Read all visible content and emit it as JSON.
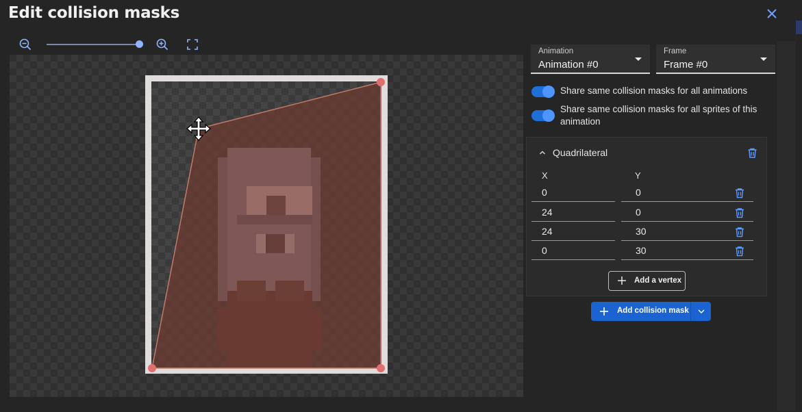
{
  "dialog": {
    "title": "Edit collision masks",
    "close_icon": "close-icon"
  },
  "toolbar": {
    "zoom_out_icon": "zoom-out-icon",
    "zoom_in_icon": "zoom-in-icon",
    "fit_icon": "fullscreen-fit-icon",
    "zoom_level_fraction": 0.96
  },
  "selectors": {
    "animation": {
      "label": "Animation",
      "value": "Animation #0"
    },
    "frame": {
      "label": "Frame",
      "value": "Frame #0"
    }
  },
  "toggles": [
    {
      "label": "Share same collision masks for all animations",
      "checked": true
    },
    {
      "label": "Share same collision masks for all sprites of this animation",
      "checked": true
    }
  ],
  "mask": {
    "name": "Quadrilateral",
    "columns": {
      "x": "X",
      "y": "Y"
    },
    "vertices": [
      {
        "x": "0",
        "y": "0"
      },
      {
        "x": "24",
        "y": "0"
      },
      {
        "x": "24",
        "y": "30"
      },
      {
        "x": "0",
        "y": "30"
      }
    ],
    "add_vertex_label": "Add a vertex"
  },
  "actions": {
    "add_collision_mask_label": "Add collision mask"
  },
  "colors": {
    "accent": "#1b63d1",
    "mask_fill": "#6e3b30",
    "vertex_handle": "#e07070"
  }
}
